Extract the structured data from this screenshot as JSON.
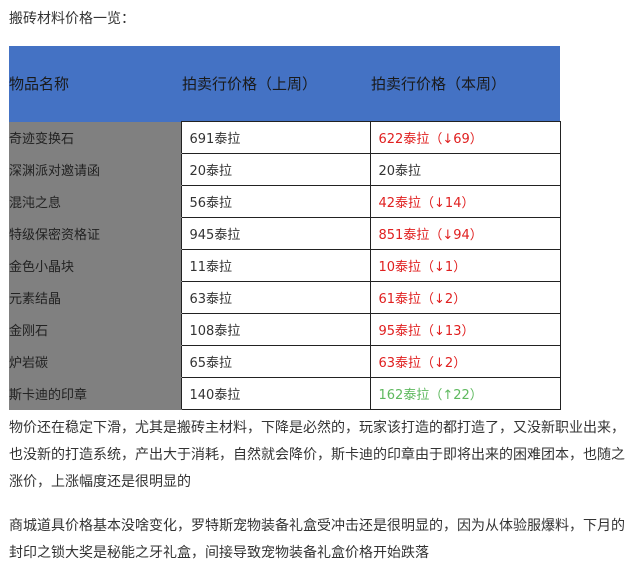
{
  "intro": "搬砖材料价格一览：",
  "table": {
    "headers": [
      "物品名称",
      "拍卖行价格（上周）",
      "拍卖行价格（本周）"
    ],
    "rows": [
      {
        "name": "奇迹变换石",
        "last_week": "691泰拉",
        "this_week": "622泰拉（↓69）",
        "trend": "down"
      },
      {
        "name": "深渊派对邀请函",
        "last_week": "20泰拉",
        "this_week": "20泰拉",
        "trend": "same"
      },
      {
        "name": "混沌之息",
        "last_week": "56泰拉",
        "this_week": "42泰拉（↓14）",
        "trend": "down"
      },
      {
        "name": "特级保密资格证",
        "last_week": "945泰拉",
        "this_week": "851泰拉（↓94）",
        "trend": "down"
      },
      {
        "name": "金色小晶块",
        "last_week": "11泰拉",
        "this_week": "10泰拉（↓1）",
        "trend": "down"
      },
      {
        "name": "元素结晶",
        "last_week": "63泰拉",
        "this_week": "61泰拉（↓2）",
        "trend": "down"
      },
      {
        "name": "金刚石",
        "last_week": "108泰拉",
        "this_week": "95泰拉（↓13）",
        "trend": "down"
      },
      {
        "name": "炉岩碳",
        "last_week": "65泰拉",
        "this_week": "63泰拉（↓2）",
        "trend": "down"
      },
      {
        "name": "斯卡迪的印章",
        "last_week": "140泰拉",
        "this_week": "162泰拉（↑22）",
        "trend": "up"
      }
    ]
  },
  "paragraphs": [
    "物价还在稳定下滑，尤其是搬砖主材料，下降是必然的，玩家该打造的都打造了，又没新职业出来，也没新的打造系统，产出大于消耗，自然就会降价，斯卡迪的印章由于即将出来的困难团本，也随之涨价，上涨幅度还是很明显的",
    "商城道具价格基本没啥变化，罗特斯宠物装备礼盒受冲击还是很明显的，因为从体验服爆料，下月的封印之锁大奖是秘能之牙礼盒，间接导致宠物装备礼盒价格开始跌落"
  ],
  "colors": {
    "header_bg": "#4472c4",
    "name_col_bg": "#808080",
    "price_down": "#e02020",
    "price_up": "#5fb95f"
  }
}
